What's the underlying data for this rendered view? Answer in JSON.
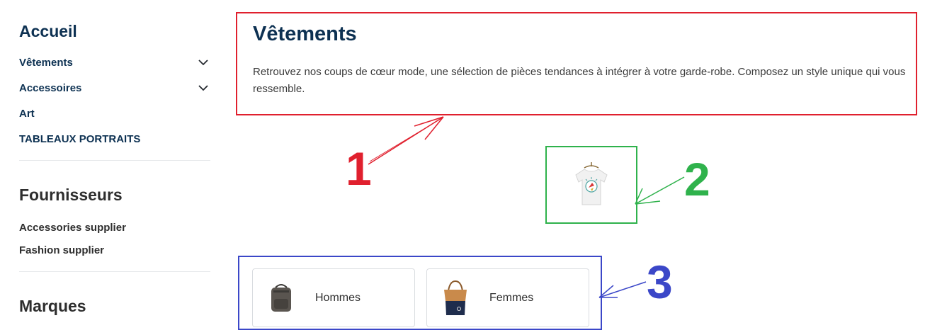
{
  "sidebar": {
    "home_heading": "Accueil",
    "categories": [
      {
        "label": "Vêtements",
        "expandable": true
      },
      {
        "label": "Accessoires",
        "expandable": true
      },
      {
        "label": "Art",
        "expandable": false
      },
      {
        "label": "TABLEAUX PORTRAITS",
        "expandable": false
      }
    ],
    "suppliers_heading": "Fournisseurs",
    "suppliers": [
      "Accessories supplier",
      "Fashion supplier"
    ],
    "brands_heading": "Marques"
  },
  "category": {
    "title": "Vêtements",
    "description": "Retrouvez nos coups de cœur mode, une sélection de pièces tendances à intégrer à votre garde-robe. Composez un style unique qui vous ressemble."
  },
  "subcategories": [
    {
      "label": "Hommes",
      "icon": "backpack-icon"
    },
    {
      "label": "Femmes",
      "icon": "handbag-icon"
    }
  ],
  "annotations": [
    "1",
    "2",
    "3"
  ],
  "colors": {
    "primary": "#0d3152",
    "annotation_1": "#e0202e",
    "annotation_2": "#2fb24c",
    "annotation_3": "#3b47c8"
  }
}
